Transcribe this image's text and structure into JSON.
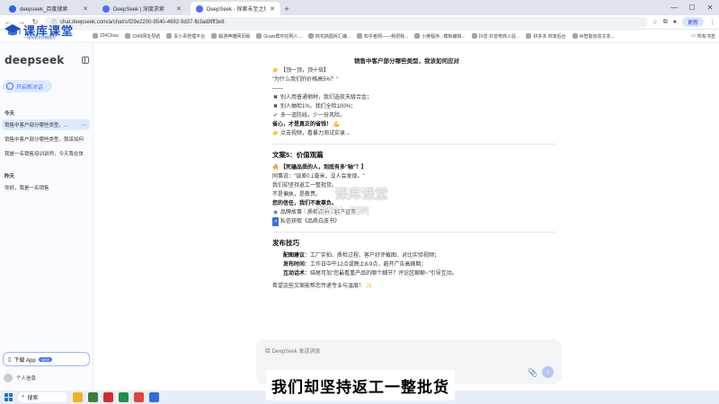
{
  "browser": {
    "tabs": [
      {
        "label": "deepseek_百度搜索",
        "active": false
      },
      {
        "label": "DeepSeek | 深度求索",
        "active": false
      },
      {
        "label": "DeepSeek - 探索未至之境",
        "active": true
      }
    ],
    "address": "chat.deepseek.com/a/chat/s/f29e2200-9540-4692-9d37-fb3ad8fff3e8",
    "update_label": "更新",
    "bookmarks": [
      "234Clouc",
      "2345网址导航",
      "青小青管理平台",
      "毅游神雕网页版",
      "Grass帮你挖网人...",
      "搞花搞图拆汇编...",
      "知乎者网——我把我...",
      "小微程序...模板编辑...",
      "抖音·抖音电商入驻...",
      "拼多多 商家后台",
      "AI智能创造文本..."
    ],
    "all_bookmarks": "所有书签"
  },
  "watermark": {
    "logo_text": "课库课堂",
    "logo_sub": "一站式职业技能提升",
    "mid_text": "课库课堂",
    "mid_url": "KEKU.COM"
  },
  "sidebar": {
    "logo": "deepseek",
    "new_chat": "开启新对话",
    "groups": [
      {
        "label": "今天",
        "items": [
          {
            "title": "销售中客户部分哪些类型、...",
            "active": true
          },
          {
            "title": "销售中客户部分哪些类型，我该如何",
            "active": false
          },
          {
            "title": "我是一名销售培训讲师，今天我在体",
            "active": false
          }
        ]
      },
      {
        "label": "昨天",
        "items": [
          {
            "title": "你好，我是一名销售",
            "active": false
          }
        ]
      }
    ],
    "download_app": "下载 App",
    "download_badge": "NEW",
    "profile": "个人信息"
  },
  "main": {
    "title": "销售中客户部分哪些类型，我该如何应对",
    "block1": {
      "top_quote": "【顶一顶，顶十倍】",
      "question": "\"为什么我们的价格高5%？\"",
      "divider": "——",
      "lines": [
        "别人用普通钢材，我们选航天级合金；",
        "别人抽检1%，我们全检100%；",
        "多一道防线，少一份风险。"
      ],
      "bold_line": "省心，才是真正的省钱！",
      "cta": "点击视频，看暴力测试实录→"
    },
    "block2": {
      "heading": "文案5：价值观篇",
      "title_line": "【死磕品质的人，到底有多\"轴\"？】",
      "lines": [
        "同事说：\"误差0.1毫米，没人会发现。\"",
        "我们却坚持返工一整批货。",
        "不是偏执，是敬畏。"
      ],
      "bold_line": "您的信任，我们不敢辜负。",
      "tag_line": "品牌故事｜质检实拍｜客户证言",
      "link_line": "私信获取《品质白皮书》"
    },
    "block3": {
      "heading": "发布技巧",
      "items": [
        {
          "label": "配图建议",
          "text": "：工厂实拍、质检过程、客户好评截图、对比实验视频；"
        },
        {
          "label": "发布时间",
          "text": "：工作日中午12点或晚上8-9点，避开广告高峰期；"
        },
        {
          "label": "互动话术",
          "text": "：结尾可加\"您最看重产品的哪个细节？评论区聊聊~\"引导互动。"
        }
      ],
      "closing": "希望这些文案能帮您传递专业与温度！"
    },
    "composer_placeholder": "给 DeepSeek 发送消息"
  },
  "subtitle": "我们却坚持返工一整批货",
  "taskbar": {
    "search": "搜索"
  }
}
